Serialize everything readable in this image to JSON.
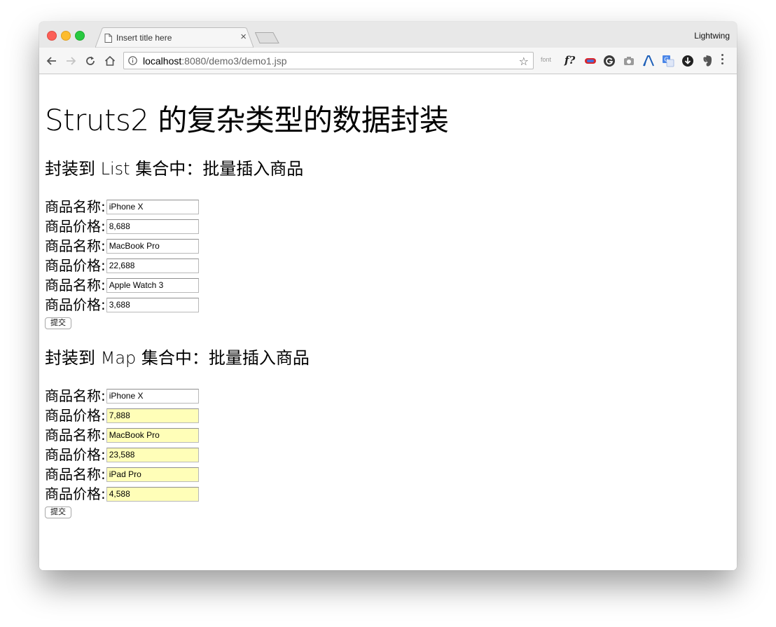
{
  "browser": {
    "tab_title": "Insert title here",
    "profile_name": "Lightwing",
    "url_host": "localhost",
    "url_rest": ":8080/demo3/demo1.jsp",
    "extensions": [
      "font",
      "f?",
      "ext-badge-icon",
      "g-icon",
      "camera-icon",
      "lambda-icon",
      "translate-icon",
      "download-icon",
      "evernote-icon"
    ]
  },
  "page": {
    "heading": "Struts2 的复杂类型的数据封装",
    "list_section": {
      "title": "封装到 List 集合中：批量插入商品",
      "rows": [
        {
          "label": "商品名称:",
          "value": "iPhone X"
        },
        {
          "label": "商品价格:",
          "value": "8,688"
        },
        {
          "label": "商品名称:",
          "value": "MacBook Pro"
        },
        {
          "label": "商品价格:",
          "value": "22,688"
        },
        {
          "label": "商品名称:",
          "value": "Apple Watch 3"
        },
        {
          "label": "商品价格:",
          "value": "3,688"
        }
      ],
      "submit_label": "提交"
    },
    "map_section": {
      "title": "封装到 Map 集合中：批量插入商品",
      "rows": [
        {
          "label": "商品名称:",
          "value": "iPhone X",
          "autofill": false
        },
        {
          "label": "商品价格:",
          "value": "7,888",
          "autofill": true
        },
        {
          "label": "商品名称:",
          "value": "MacBook Pro",
          "autofill": true
        },
        {
          "label": "商品价格:",
          "value": "23,588",
          "autofill": true
        },
        {
          "label": "商品名称:",
          "value": "iPad Pro",
          "autofill": true
        },
        {
          "label": "商品价格:",
          "value": "4,588",
          "autofill": true
        }
      ],
      "submit_label": "提交"
    }
  },
  "colors": {
    "autofill_bg": "#fffeb8",
    "close": "#fc5f57",
    "minimize": "#fdbc2e",
    "maximize": "#28c940"
  }
}
